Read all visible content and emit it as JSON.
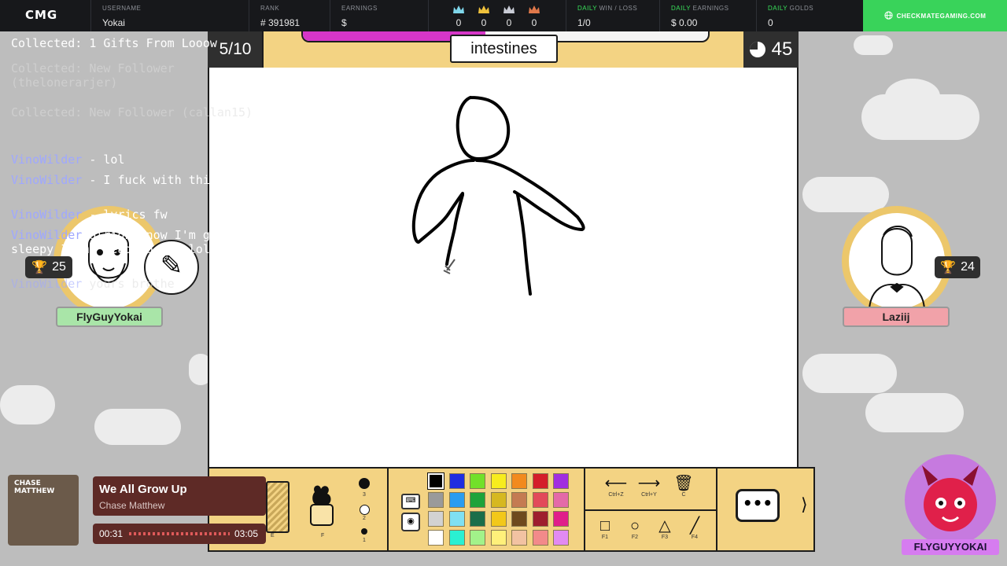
{
  "topbar": {
    "logo": "CMG",
    "username_label": "USERNAME",
    "username": "Yokai",
    "rank_label": "RANK",
    "rank": "# 391981",
    "earnings_label": "EARNINGS",
    "earnings": "$",
    "crowns": [
      {
        "icon": "crown-icon",
        "color": "#7fd6ea",
        "value": "0"
      },
      {
        "icon": "crown-icon",
        "color": "#f0c23c",
        "value": "0"
      },
      {
        "icon": "crown-icon",
        "color": "#c9ccd6",
        "value": "0"
      },
      {
        "icon": "crown-icon",
        "color": "#e0784a",
        "value": "0"
      }
    ],
    "daily_wl_label_a": "DAILY",
    "daily_wl_label_b": "WIN / LOSS",
    "daily_wl": "1/0",
    "daily_earn_label_a": "DAILY",
    "daily_earn_label_b": "EARNINGS",
    "daily_earn": "$ 0.00",
    "daily_golds_label_a": "DAILY",
    "daily_golds_label_b": "GOLDS",
    "daily_golds": "0",
    "site_button": "CHECKMATEGAMING.COM",
    "accent": "#39d35a"
  },
  "game": {
    "round": "5/10",
    "word": "intestines",
    "timer": "45",
    "progress": 0.45
  },
  "players": {
    "left": {
      "name": "FlyGuyYokai",
      "trophies": "25",
      "plate_color": "#a9e5a8"
    },
    "right": {
      "name": "Laziij",
      "trophies": "24",
      "plate_color": "#f1a2a9"
    }
  },
  "chat_overlay": {
    "lines": [
      {
        "text": "Collected: 1 Gifts From Looow",
        "style": "white"
      },
      {
        "text": "Collected: New Follower (thelonerarjer)",
        "style": "faded"
      },
      {
        "text": "Collected: New Follower (callan15)",
        "style": "faded"
      },
      {
        "user": "VinoWilder",
        "text": "- lol",
        "style": "white"
      },
      {
        "user": "VinoWilder",
        "text": "- I fuck with this too",
        "style": "white"
      },
      {
        "user": "VinoWilder",
        "text": "- lyrics fw",
        "style": "white"
      },
      {
        "user": "VinoWilder",
        "text": "alright now I'm getting sleepy I'mma head to bed lol",
        "style": "white"
      },
      {
        "user": "VinoWilder",
        "text": "yours brothe",
        "style": "faded"
      }
    ]
  },
  "toolbar": {
    "brush_sizes": [
      "3",
      "2",
      "1"
    ],
    "brush_keys": [
      "E",
      "F"
    ],
    "palette": [
      "#000000",
      "#1f2de0",
      "#72e02a",
      "#f7ec1e",
      "#f28a1e",
      "#d41e2a",
      "#a12ee0",
      "#9a9a9a",
      "#2a9cf0",
      "#1ea33a",
      "#d6b820",
      "#c47b52",
      "#e24a5a",
      "#e46aa8",
      "#d2d2d2",
      "#7fe0f2",
      "#1a6e4a",
      "#f2c81a",
      "#6e4a1e",
      "#9e1e2e",
      "#e01e8a",
      "#ffffff",
      "#2af0d2",
      "#a2f28a",
      "#fff07a",
      "#f2c2a2",
      "#f28a8a",
      "#e28af2"
    ],
    "undo_key": "Ctrl+Z",
    "redo_key": "Ctrl+Y",
    "clear_key": "C",
    "shape_keys": [
      "F1",
      "F2",
      "F3",
      "F4"
    ],
    "chat_glyph": "•••",
    "collapse_glyph": "⟩"
  },
  "music": {
    "title": "We All Grow Up",
    "artist": "Chase Matthew",
    "elapsed": "00:31",
    "duration": "03:05",
    "album_text": "CHASE MATTHEW",
    "accent": "#5e2a26"
  },
  "streamer_tag": "FLYGUYYOKAI"
}
